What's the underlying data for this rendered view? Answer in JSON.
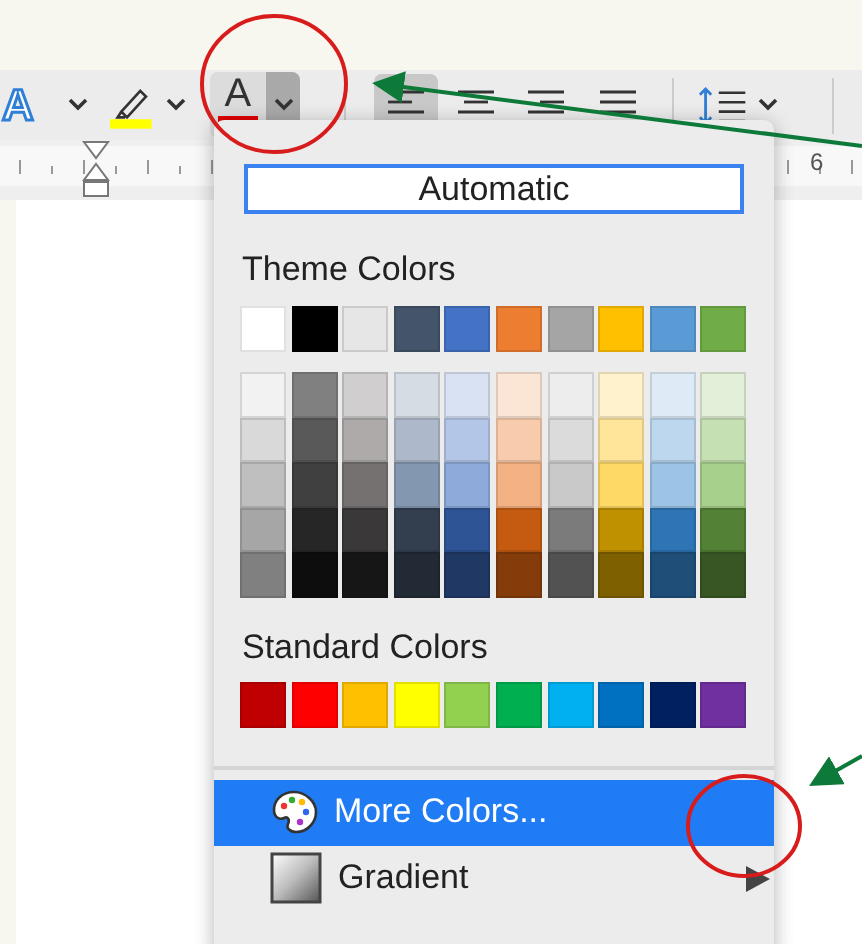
{
  "toolbar": {
    "items": [
      {
        "kind": "text-effects",
        "glyph": "A"
      },
      {
        "kind": "chevron"
      },
      {
        "kind": "highlighter",
        "color": "#ffff00"
      },
      {
        "kind": "chevron"
      },
      {
        "kind": "font-color",
        "glyph": "A",
        "color": "#e00000",
        "expanded": true
      },
      {
        "kind": "divider"
      },
      {
        "kind": "align-left",
        "selected": true
      },
      {
        "kind": "align-center",
        "selected": false
      },
      {
        "kind": "align-right",
        "selected": false
      },
      {
        "kind": "justify",
        "selected": false
      },
      {
        "kind": "divider"
      },
      {
        "kind": "line-spacing"
      },
      {
        "kind": "chevron"
      },
      {
        "kind": "divider"
      }
    ]
  },
  "ruler": {
    "number": "6"
  },
  "color_menu": {
    "automatic": "Automatic",
    "theme_label": "Theme Colors",
    "theme_colors": [
      {
        "color": "#ffffff"
      },
      {
        "color": "#000000"
      },
      {
        "color": "#e7e6e6"
      },
      {
        "color": "#44546a"
      },
      {
        "color": "#4472c4"
      },
      {
        "color": "#ed7d31"
      },
      {
        "color": "#a5a5a5"
      },
      {
        "color": "#ffc000"
      },
      {
        "color": "#5b9bd5"
      },
      {
        "color": "#70ad47"
      }
    ],
    "shades": [
      {
        "swatches": [
          {
            "color": "#f2f2f2"
          },
          {
            "color": "#d9d9d9"
          },
          {
            "color": "#bfbfbf"
          },
          {
            "color": "#a6a6a6"
          },
          {
            "color": "#808080"
          }
        ]
      },
      {
        "swatches": [
          {
            "color": "#808080"
          },
          {
            "color": "#595959"
          },
          {
            "color": "#404040"
          },
          {
            "color": "#262626"
          },
          {
            "color": "#0d0d0d"
          }
        ]
      },
      {
        "swatches": [
          {
            "color": "#d0cece"
          },
          {
            "color": "#aeaaaa"
          },
          {
            "color": "#757171"
          },
          {
            "color": "#3a3838"
          },
          {
            "color": "#171616"
          }
        ]
      },
      {
        "swatches": [
          {
            "color": "#d6dce4"
          },
          {
            "color": "#adb9ca"
          },
          {
            "color": "#8497b0"
          },
          {
            "color": "#333f4f"
          },
          {
            "color": "#222a35"
          }
        ]
      },
      {
        "swatches": [
          {
            "color": "#d9e2f3"
          },
          {
            "color": "#b4c6e7"
          },
          {
            "color": "#8eaadb"
          },
          {
            "color": "#2f5496"
          },
          {
            "color": "#1f3864"
          }
        ]
      },
      {
        "swatches": [
          {
            "color": "#fbe5d5"
          },
          {
            "color": "#f7cbac"
          },
          {
            "color": "#f4b183"
          },
          {
            "color": "#c55a11"
          },
          {
            "color": "#843c0b"
          }
        ]
      },
      {
        "swatches": [
          {
            "color": "#ededed"
          },
          {
            "color": "#dbdbdb"
          },
          {
            "color": "#c9c9c9"
          },
          {
            "color": "#7b7b7b"
          },
          {
            "color": "#525252"
          }
        ]
      },
      {
        "swatches": [
          {
            "color": "#fff2cc"
          },
          {
            "color": "#ffe599"
          },
          {
            "color": "#ffd966"
          },
          {
            "color": "#bf9000"
          },
          {
            "color": "#7f6000"
          }
        ]
      },
      {
        "swatches": [
          {
            "color": "#deebf6"
          },
          {
            "color": "#bdd7ee"
          },
          {
            "color": "#9dc3e6"
          },
          {
            "color": "#2e75b5"
          },
          {
            "color": "#1f4e79"
          }
        ]
      },
      {
        "swatches": [
          {
            "color": "#e2efd9"
          },
          {
            "color": "#c5e0b3"
          },
          {
            "color": "#a8d08d"
          },
          {
            "color": "#538135"
          },
          {
            "color": "#375623"
          }
        ]
      }
    ],
    "standard_label": "Standard Colors",
    "standard_colors": [
      {
        "color": "#c00000"
      },
      {
        "color": "#ff0000"
      },
      {
        "color": "#ffc000"
      },
      {
        "color": "#ffff00"
      },
      {
        "color": "#92d050"
      },
      {
        "color": "#00b050"
      },
      {
        "color": "#00b0f0"
      },
      {
        "color": "#0070c0"
      },
      {
        "color": "#002060"
      },
      {
        "color": "#7030a0"
      }
    ],
    "items": [
      {
        "kind": "more-colors",
        "label": "More Colors...",
        "selected": true
      },
      {
        "kind": "gradient",
        "label": "Gradient",
        "selected": false
      }
    ]
  }
}
